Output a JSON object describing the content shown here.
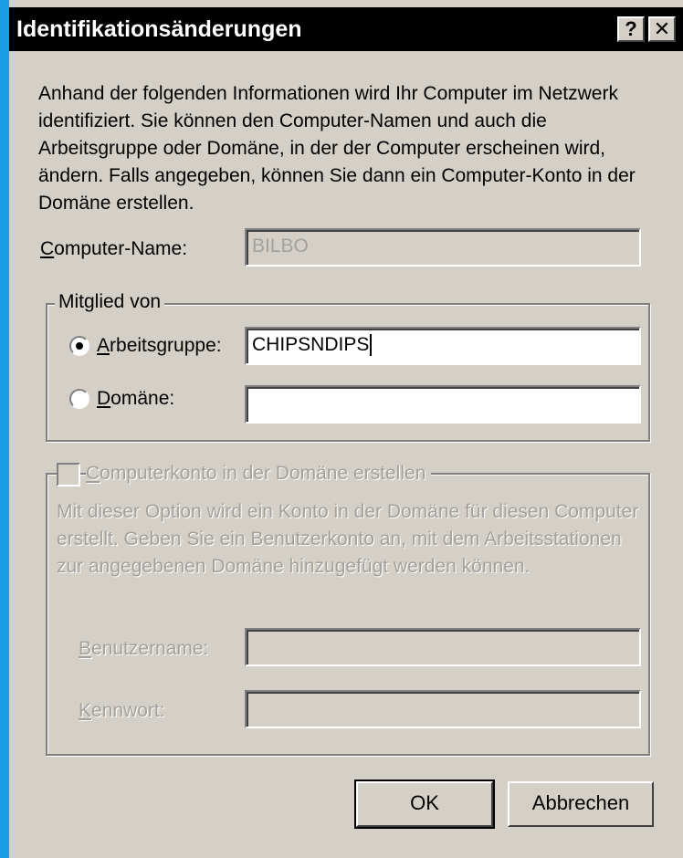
{
  "dialog": {
    "title": "Identifikationsänderungen",
    "help_button": "?",
    "close_button": "✕"
  },
  "description": "Anhand der folgenden Informationen wird Ihr Computer im Netzwerk identifiziert. Sie können den Computer-Namen und auch die Arbeitsgruppe oder Domäne, in der der Computer erscheinen wird, ändern. Falls angegeben, können Sie dann ein Computer-Konto in der Domäne erstellen.",
  "computer_name": {
    "label_first": "C",
    "label_rest": "omputer-Name:",
    "value": "BILBO"
  },
  "member_of": {
    "legend": "Mitglied von",
    "workgroup": {
      "label_first": "A",
      "label_rest": "rbeitsgruppe:",
      "value": "CHIPSNDIPS",
      "selected": true
    },
    "domain": {
      "label_first": "D",
      "label_rest": "omäne:",
      "value": "",
      "selected": false
    }
  },
  "account": {
    "checkbox_label_first": "C",
    "checkbox_label_rest": "omputerkonto in der Domäne erstellen",
    "checked": false,
    "description": "Mit dieser Option wird ein Konto in der Domäne für diesen Computer erstellt. Geben Sie ein Benutzerkonto an, mit dem Arbeitsstationen zur angegebenen Domäne hinzugefügt werden können.",
    "username": {
      "label_first": "B",
      "label_rest": "enutzername:",
      "value": ""
    },
    "password": {
      "label_first": "K",
      "label_rest": "ennwort:",
      "value": ""
    }
  },
  "buttons": {
    "ok": "OK",
    "cancel": "Abbrechen"
  }
}
